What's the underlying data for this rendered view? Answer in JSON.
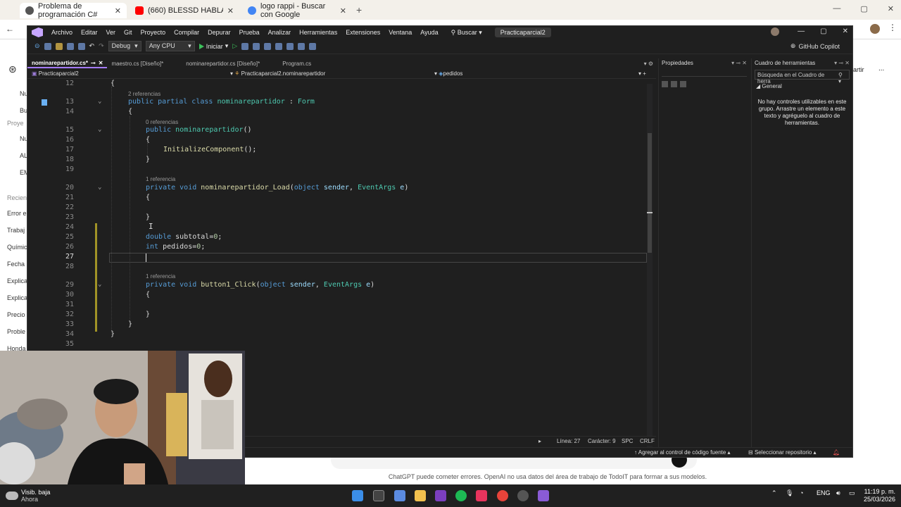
{
  "browser": {
    "tabs": [
      {
        "title": "Problema de programación C#",
        "active": true
      },
      {
        "title": "(660) BLESSD HABLA DE LOS C",
        "active": false
      },
      {
        "title": "logo rappi - Buscar con Google",
        "active": false
      }
    ],
    "new_tab": "+",
    "sidebar_labels": [
      "Nu",
      "Bu",
      "Proye",
      "Nu",
      "AL",
      "EM",
      "Recien",
      "Error e",
      "Trabaj",
      "Químic",
      "Fecha",
      "Explica",
      "Explica",
      "Precio",
      "Proble",
      "Honda"
    ],
    "right_label": "artir",
    "right_more": "...",
    "disclaimer": "ChatGPT puede cometer errores. OpenAI no usa datos del área de trabajo de TodoIT para formar a sus modelos."
  },
  "vs": {
    "menu": [
      "Archivo",
      "Editar",
      "Ver",
      "Git",
      "Proyecto",
      "Compilar",
      "Depurar",
      "Prueba",
      "Analizar",
      "Herramientas",
      "Extensiones",
      "Ventana",
      "Ayuda"
    ],
    "search": "Buscar",
    "solution": "Practicaparcial2",
    "toolbar": {
      "config": "Debug",
      "platform": "Any CPU",
      "run": "Iniciar",
      "copilot": "GitHub Copilot"
    },
    "doc_tabs": [
      {
        "label": "nominarepartidor.cs*",
        "active": true
      },
      {
        "label": "maestro.cs [Diseño]*",
        "active": false
      },
      {
        "label": "nominarepartidor.cs [Diseño]*",
        "active": false
      },
      {
        "label": "Program.cs",
        "active": false
      }
    ],
    "nav": {
      "project": "Practicaparcial2",
      "type": "Practicaparcial2.nominarepartidor",
      "member": "pedidos"
    },
    "codelens": {
      "l13": "2 referencias",
      "l15": "0 referencias",
      "l20": "1 referencia",
      "l29": "1 referencia"
    },
    "line_numbers": [
      "12",
      "13",
      "14",
      "15",
      "16",
      "17",
      "18",
      "19",
      "20",
      "21",
      "22",
      "23",
      "24",
      "25",
      "26",
      "27",
      "28",
      "29",
      "30",
      "31",
      "32",
      "33",
      "34",
      "35"
    ],
    "code": {
      "l12": "{",
      "l13_kw": "public partial class",
      "l13_name": "nominarepartidor",
      "l13_colon": ":",
      "l13_base": "Form",
      "l14": "{",
      "l15_kw": "public",
      "l15_fn": "nominarepartidor",
      "l15_rest": "()",
      "l16": "{",
      "l17_fn": "InitializeComponent",
      "l17_rest": "();",
      "l18": "}",
      "l20_kw": "private void",
      "l20_fn": "nominarepartidor_Load",
      "l20_p1t": "object",
      "l20_p1": "sender",
      "l20_p2t": "EventArgs",
      "l20_p2": "e",
      "l21": "{",
      "l23": "}",
      "l25_kw": "double",
      "l25_var": "subtotal",
      "l25_val": "0",
      "l26_kw": "int",
      "l26_var": "pedidos",
      "l26_val": "0",
      "l29_kw": "private void",
      "l29_fn": "button1_Click",
      "l29_p1t": "object",
      "l29_p1": "sender",
      "l29_p2t": "EventArgs",
      "l29_p2": "e",
      "l30": "{",
      "l32": "}",
      "l33": "}",
      "l34": "}"
    },
    "status": {
      "line": "Línea: 27",
      "col": "Carácter: 9",
      "spc": "SPC",
      "crlf": "CRLF"
    },
    "bottom": {
      "source_control": "Agregar al control de código fuente",
      "repo": "Seleccionar repositorio"
    },
    "properties": {
      "title": "Propiedades"
    },
    "toolbox": {
      "title": "Cuadro de herramientas",
      "search": "Búsqueda en el Cuadro de herra",
      "group": "General",
      "empty": "No hay controles utilizables en este grupo. Arrastre un elemento a este texto y agréguelo al cuadro de herramientas."
    }
  },
  "taskbar": {
    "weather_line1": "Visib. baja",
    "weather_line2": "Ahora",
    "lang": "ENG",
    "time": "11:19 p. m.",
    "date": "25/03/2026"
  },
  "colors": {
    "vs_accent": "#a57bff",
    "keyword": "#569cd6",
    "type": "#4ec9b0",
    "function": "#dcdcaa"
  }
}
